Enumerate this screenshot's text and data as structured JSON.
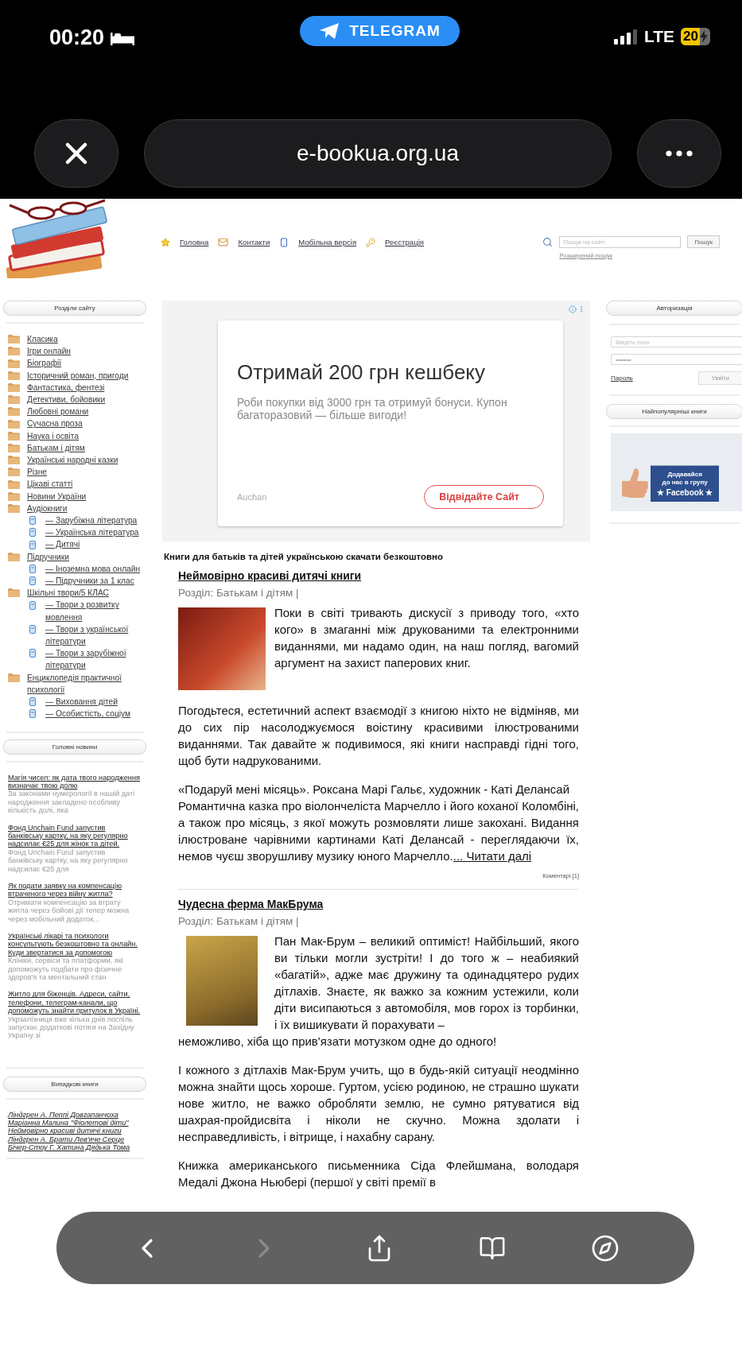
{
  "status_bar": {
    "time": "00:20",
    "app_pill": "TELEGRAM",
    "network": "LTE",
    "battery": "20"
  },
  "browser": {
    "url": "e-bookua.org.ua"
  },
  "site_header": {
    "nav": [
      {
        "kind": "home",
        "label": "Головна"
      },
      {
        "kind": "contacts",
        "label": "Контакти"
      },
      {
        "kind": "mobile",
        "label": "Мобільна версія"
      },
      {
        "kind": "register",
        "label": "Реєстрація"
      }
    ],
    "search": {
      "placeholder": "Пошук на сайті",
      "button": "Пошук",
      "advanced_link": "Розширений пошук"
    }
  },
  "left_sidebar": {
    "sections_title": "Розділи сайту",
    "categories": [
      {
        "label": "Класика"
      },
      {
        "label": "Ігри онлайн"
      },
      {
        "label": "Біографії"
      },
      {
        "label": "Історичний роман, пригоди"
      },
      {
        "label": "Фантастика, фентезі"
      },
      {
        "label": "Детективи, бойовики"
      },
      {
        "label": "Любовні романи"
      },
      {
        "label": "Сучасна проза"
      },
      {
        "label": "Наука і освіта"
      },
      {
        "label": "Батькам і дітям"
      },
      {
        "label": "Українські народні казки"
      },
      {
        "label": "Різне"
      },
      {
        "label": "Цікаві статті"
      },
      {
        "label": "Новини України"
      },
      {
        "label": "Аудіокниги",
        "children": [
          {
            "label": "— Зарубіжна література"
          },
          {
            "label": "— Українська література"
          },
          {
            "label": "— Дитячі"
          }
        ]
      },
      {
        "label": "Підручники",
        "children": [
          {
            "label": "— Іноземна мова онлайн"
          },
          {
            "label": "— Підручники за 1 клас"
          }
        ]
      },
      {
        "label": "Шкільні твори/5 КЛАС",
        "children": [
          {
            "label": "— Твори з розвитку мовлення"
          },
          {
            "label": "— Твори з української літератури"
          },
          {
            "label": "— Твори з зарубіжної літератури"
          }
        ]
      },
      {
        "label": "Енциклопедія практичної психології",
        "children": [
          {
            "label": "— Виховання дітей"
          },
          {
            "label": "— Особистість, соціум"
          }
        ]
      }
    ],
    "news_title": "Головні новини",
    "news": [
      {
        "title": "Магія чисел: як дата твого народження визначає твою долю",
        "summary": "За законами нумерології в нашій даті народження закладено особливу кількість долі, яка"
      },
      {
        "title": "Фонд Unchain Fund запустив банківську картку, на яку регулярно надсилає €25 для жінок та дітей.",
        "summary": "Фонд Unchain Fund запустив банківську картку, на яку регулярно надсилає €25 для"
      },
      {
        "title": "Як подати заявку на компенсацію втраченого через війну житла?",
        "summary": "Отримати компенсацію за втрату житла через бойові дії тепер можна через мобільний додаток..."
      },
      {
        "title": "Українські лікарі та психологи консультують безкоштовно та онлайн. Куди звертатися за допомогою",
        "summary": "Клініки, сервіси та платформи, які допоможуть подбати про фізичне здоров'я та ментальний стан"
      },
      {
        "title": "Житло для біженців. Адреси, сайти, телефони, телеграм-канали, що допоможуть знайти притулок в Україні.",
        "summary": "Укрзалізниця вже кілька днів поспіль запускає додаткові потяги на Західну Україну зі"
      }
    ],
    "random_title": "Випадкові книги",
    "random_books": [
      "Ліндгрен А. Пеппі Довгапанчоха",
      "Маріанна Малина \"Фіолетові діти\"",
      "Неймовірно красиві дитячі книги",
      "Ліндгрен А. Брати Лев'яче Серце",
      "Бічер-Стоу Г. Хатина Дядька Тома"
    ]
  },
  "ad": {
    "title": "Отримай 200 грн кешбеку",
    "body": "Роби покупки від 3000 грн та отримуй бонуси. Купон багаторазовий — більше вигоди!",
    "advertiser": "Auchan",
    "button": "Відвідайте Сайт"
  },
  "content": {
    "heading": "Книги для батьків та дітей українською скачати безкоштовно",
    "articles": [
      {
        "title": "Неймовірно красиві дитячі книги",
        "section": "Розділ: Батькам і дітям |",
        "intro": "Поки в світі тривають дискусії з приводу того, «хто кого» в змаганні між друкованими та електронними виданнями, ми надамо один, на наш погляд, вагомий аргумент на захист паперових книг.",
        "paragraphs": [
          "Погодьтеся, естетичний аспект взаємодії з книгою ніхто не відміняв, ми до сих пір насолоджуємося воістину красивими ілюстрованими виданнями. Так давайте ж подивимося, які книги насправді гідні того, щоб бути надрукованими."
        ],
        "featured": {
          "subtitle": "«Подаруй мені місяць». Роксана Марі Гальє, художник - Каті Делансай",
          "text": "Романтична казка про віолончеліста Марчелло і його коханої Коломбіні, а також про місяць, з якої можуть розмовляти лише закохані. Видання ілюстроване чарівними картинами Каті Делансай - переглядаючи їх, немов чуєш зворушливу музику юного Марчелло.",
          "read_more": "... Читати далі"
        },
        "comments": "Коментарі [1]"
      },
      {
        "title": "Чудесна ферма МакБрума",
        "section": "Розділ: Батькам і дітям |",
        "intro": "Пан Мак-Брум – великий оптиміст! Найбільший, якого ви тільки могли зустріти! І до того ж – неабиякий «багатій», адже має дружину та одинадцятеро рудих дітлахів. Знаєте, як важко за кожним устежили, коли діти висипаються з автомобіля, мов горох із торбинки, і їх вишикувати й порахувати –",
        "intro_tail": "неможливо, хіба що прив'язати мотузком одне до одного!",
        "paragraphs": [
          "І кожного з дітлахів Мак-Брум учить, що в будь-якій ситуації неодмінно можна знайти щось хороше. Гуртом, усією родиною, не страшно шукати нове житло, не важко обробляти землю, не сумно рятуватися від шахрая-пройдисвіта і ніколи не скучно. Можна здолати і несправедливість, і вітрище, і нахабну сарану.",
          "Книжка американського письменника Сіда Флейшмана, володаря Медалі Джона Ньюбері (першої у світі премії в"
        ]
      }
    ]
  },
  "right_sidebar": {
    "auth_title": "Авторизація",
    "login_placeholder": "Введіть логін",
    "password_value": "••••••••",
    "password_link": "Пароль",
    "login_button": "Увійти",
    "popular_title": "Найпопулярніші книги",
    "banner": {
      "line1": "Додавайся",
      "line2": "до нас в групу",
      "line3": "★ Facebook ★"
    }
  },
  "bottom_toolbar": {
    "buttons": [
      {
        "kind": "back",
        "disabled": false
      },
      {
        "kind": "forward",
        "disabled": true
      },
      {
        "kind": "share",
        "disabled": false
      },
      {
        "kind": "bookmarks",
        "disabled": false
      },
      {
        "kind": "compass",
        "disabled": false
      }
    ]
  }
}
